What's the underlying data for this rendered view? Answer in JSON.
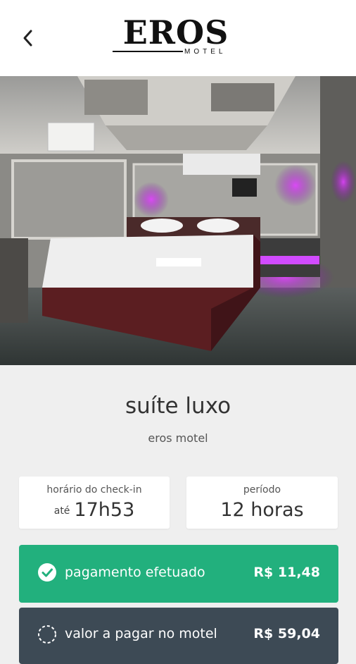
{
  "header": {
    "back_icon": "chevron-left-icon",
    "logo_text": "EROS",
    "logo_subtext": "MOTEL"
  },
  "room": {
    "name": "suíte luxo",
    "motel": "eros motel"
  },
  "checkin": {
    "label": "horário do check-in",
    "prefix": "até",
    "time": "17h53"
  },
  "period": {
    "label": "período",
    "value": "12 horas"
  },
  "payment": {
    "icon": "check-circle-icon",
    "label": "pagamento efetuado",
    "amount": "R$ 11,48",
    "color": "#22b07d"
  },
  "due": {
    "icon": "dashed-circle-icon",
    "label": "valor a pagar no motel",
    "amount": "R$ 59,04",
    "color": "#3d4a55"
  }
}
